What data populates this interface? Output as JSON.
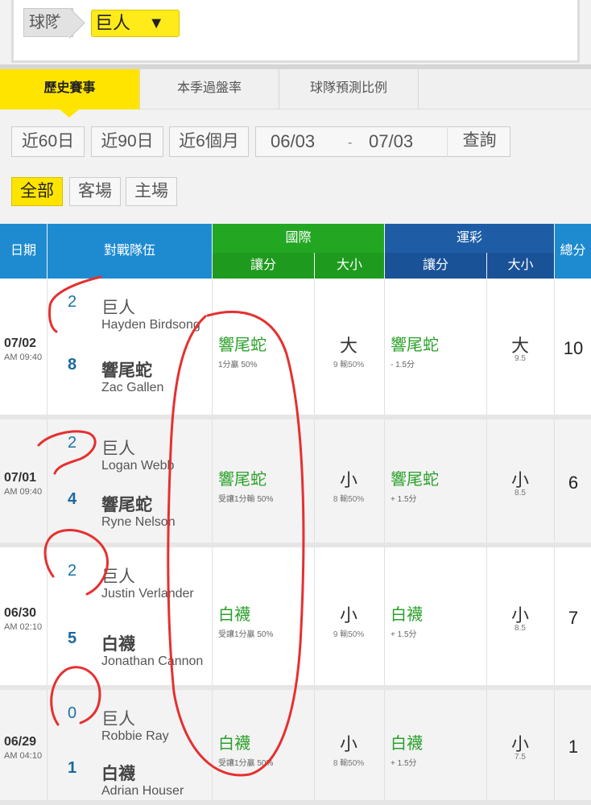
{
  "team_filter": {
    "label": "球隊",
    "selected": "巨人"
  },
  "tabs": [
    "歷史賽事",
    "本季過盤率",
    "球隊預測比例"
  ],
  "range_buttons": [
    "近60日",
    "近90日",
    "近6個月"
  ],
  "date_range": {
    "from": "06/03",
    "sep": "-",
    "to": "07/03",
    "query": "查詢"
  },
  "venue_buttons": [
    "全部",
    "客場",
    "主場"
  ],
  "headers": {
    "date": "日期",
    "teams": "對戰隊伍",
    "intl": "國際",
    "sportslottery": "運彩",
    "spread": "讓分",
    "ou": "大小",
    "total": "總分"
  },
  "games": [
    {
      "date": "07/02",
      "time": "AM 09:40",
      "away": {
        "score": "2",
        "team": "巨人",
        "pitcher": "Hayden Birdsong"
      },
      "home": {
        "score": "8",
        "team": "響尾蛇",
        "pitcher": "Zac Gallen"
      },
      "intl_pick": "響尾蛇",
      "intl_pick_sub": "1分贏 50%",
      "intl_ou": "大",
      "intl_ou_sub": "9 輸50%",
      "lot_pick": "響尾蛇",
      "lot_pick_sub": "- 1.5分",
      "lot_ou": "大",
      "lot_ou_sub": "9.5",
      "total": "10"
    },
    {
      "date": "07/01",
      "time": "AM 09:40",
      "away": {
        "score": "2",
        "team": "巨人",
        "pitcher": "Logan Webb"
      },
      "home": {
        "score": "4",
        "team": "響尾蛇",
        "pitcher": "Ryne Nelson"
      },
      "intl_pick": "響尾蛇",
      "intl_pick_sub": "受讓1分輸 50%",
      "intl_ou": "小",
      "intl_ou_sub": "8 輸50%",
      "lot_pick": "響尾蛇",
      "lot_pick_sub": "+ 1.5分",
      "lot_ou": "小",
      "lot_ou_sub": "8.5",
      "total": "6"
    },
    {
      "date": "06/30",
      "time": "AM 02:10",
      "away": {
        "score": "2",
        "team": "巨人",
        "pitcher": "Justin Verlander"
      },
      "home": {
        "score": "5",
        "team": "白襪",
        "pitcher": "Jonathan Cannon"
      },
      "intl_pick": "白襪",
      "intl_pick_sub": "受讓1分贏 50%",
      "intl_ou": "小",
      "intl_ou_sub": "9 輸50%",
      "lot_pick": "白襪",
      "lot_pick_sub": "+ 1.5分",
      "lot_ou": "小",
      "lot_ou_sub": "8.5",
      "total": "7"
    },
    {
      "date": "06/29",
      "time": "AM 04:10",
      "away": {
        "score": "0",
        "team": "巨人",
        "pitcher": "Robbie Ray"
      },
      "home": {
        "score": "1",
        "team": "白襪",
        "pitcher": "Adrian Houser"
      },
      "intl_pick": "白襪",
      "intl_pick_sub": "受讓1分贏 50%",
      "intl_ou": "小",
      "intl_ou_sub": "8 輸50%",
      "lot_pick": "白襪",
      "lot_pick_sub": "+ 1.5分",
      "lot_ou": "小",
      "lot_ou_sub": "7.5",
      "total": "1"
    }
  ],
  "colors": {
    "accent_yellow": "#ffe400",
    "intl_green": "#23a723",
    "lottery_navy": "#1e5da6",
    "header_blue": "#1e8bd1",
    "annotation_red": "#e53030"
  }
}
